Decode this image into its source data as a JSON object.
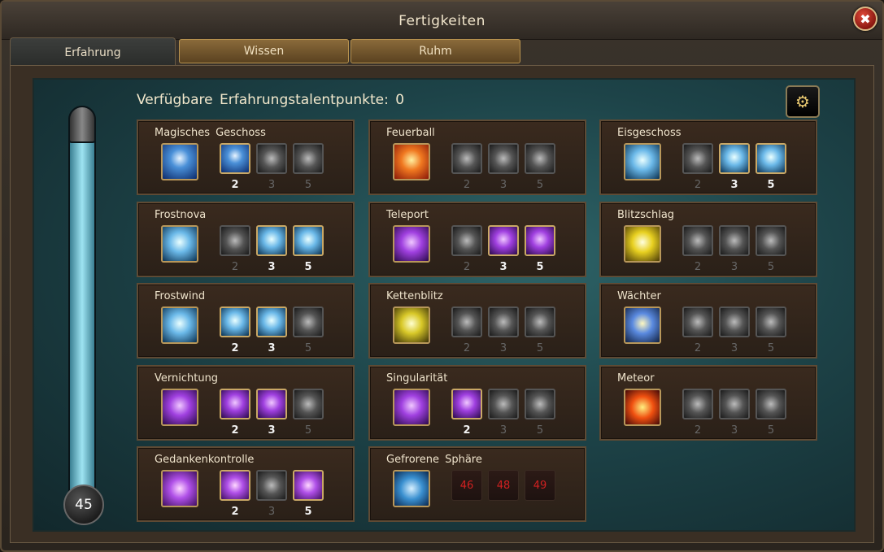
{
  "window": {
    "title": "Fertigkeiten",
    "close_glyph": "✖"
  },
  "tabs": [
    {
      "label": "Erfahrung",
      "active": true
    },
    {
      "label": "Wissen",
      "active": false
    },
    {
      "label": "Ruhm",
      "active": false
    }
  ],
  "header": {
    "points_label": "Verfügbare  Erfahrungstalentpunkte:  0"
  },
  "level": {
    "value": "45"
  },
  "settings": {
    "icon": "gear-icon",
    "glyph": "⚙"
  },
  "skills": [
    {
      "name": "Magisches  Geschoss",
      "icon": "magic-missile-icon",
      "ranks": [
        {
          "label": "2",
          "state": "on"
        },
        {
          "label": "3",
          "state": "off"
        },
        {
          "label": "5",
          "state": "off"
        }
      ]
    },
    {
      "name": "Feuerball",
      "icon": "fireball-icon",
      "ranks": [
        {
          "label": "2",
          "state": "off"
        },
        {
          "label": "3",
          "state": "off"
        },
        {
          "label": "5",
          "state": "off"
        }
      ]
    },
    {
      "name": "Eisgeschoss",
      "icon": "ice-bolt-icon",
      "ranks": [
        {
          "label": "2",
          "state": "off"
        },
        {
          "label": "3",
          "state": "on"
        },
        {
          "label": "5",
          "state": "on"
        }
      ]
    },
    {
      "name": "Frostnova",
      "icon": "frost-nova-icon",
      "ranks": [
        {
          "label": "2",
          "state": "off"
        },
        {
          "label": "3",
          "state": "on"
        },
        {
          "label": "5",
          "state": "on"
        }
      ]
    },
    {
      "name": "Teleport",
      "icon": "teleport-icon",
      "ranks": [
        {
          "label": "2",
          "state": "off"
        },
        {
          "label": "3",
          "state": "on"
        },
        {
          "label": "5",
          "state": "on"
        }
      ]
    },
    {
      "name": "Blitzschlag",
      "icon": "lightning-icon",
      "ranks": [
        {
          "label": "2",
          "state": "off"
        },
        {
          "label": "3",
          "state": "off"
        },
        {
          "label": "5",
          "state": "off"
        }
      ]
    },
    {
      "name": "Frostwind",
      "icon": "frost-wind-icon",
      "ranks": [
        {
          "label": "2",
          "state": "on"
        },
        {
          "label": "3",
          "state": "on"
        },
        {
          "label": "5",
          "state": "off"
        }
      ]
    },
    {
      "name": "Kettenblitz",
      "icon": "chain-lightning-icon",
      "ranks": [
        {
          "label": "2",
          "state": "off"
        },
        {
          "label": "3",
          "state": "off"
        },
        {
          "label": "5",
          "state": "off"
        }
      ]
    },
    {
      "name": "Wächter",
      "icon": "guardian-icon",
      "ranks": [
        {
          "label": "2",
          "state": "off"
        },
        {
          "label": "3",
          "state": "off"
        },
        {
          "label": "5",
          "state": "off"
        }
      ]
    },
    {
      "name": "Vernichtung",
      "icon": "annihilation-icon",
      "ranks": [
        {
          "label": "2",
          "state": "on"
        },
        {
          "label": "3",
          "state": "on"
        },
        {
          "label": "5",
          "state": "off"
        }
      ]
    },
    {
      "name": "Singularität",
      "icon": "singularity-icon",
      "ranks": [
        {
          "label": "2",
          "state": "on"
        },
        {
          "label": "3",
          "state": "off"
        },
        {
          "label": "5",
          "state": "off"
        }
      ]
    },
    {
      "name": "Meteor",
      "icon": "meteor-icon",
      "ranks": [
        {
          "label": "2",
          "state": "off"
        },
        {
          "label": "3",
          "state": "off"
        },
        {
          "label": "5",
          "state": "off"
        }
      ]
    },
    {
      "name": "Gedankenkontrolle",
      "icon": "mind-control-icon",
      "ranks": [
        {
          "label": "2",
          "state": "on"
        },
        {
          "label": "3",
          "state": "off"
        },
        {
          "label": "5",
          "state": "on"
        }
      ]
    },
    {
      "name": "Gefrorene  Sphäre",
      "icon": "frozen-sphere-icon",
      "ranks": [
        {
          "label": "46",
          "state": "locked"
        },
        {
          "label": "48",
          "state": "locked"
        },
        {
          "label": "49",
          "state": "locked"
        }
      ]
    }
  ]
}
